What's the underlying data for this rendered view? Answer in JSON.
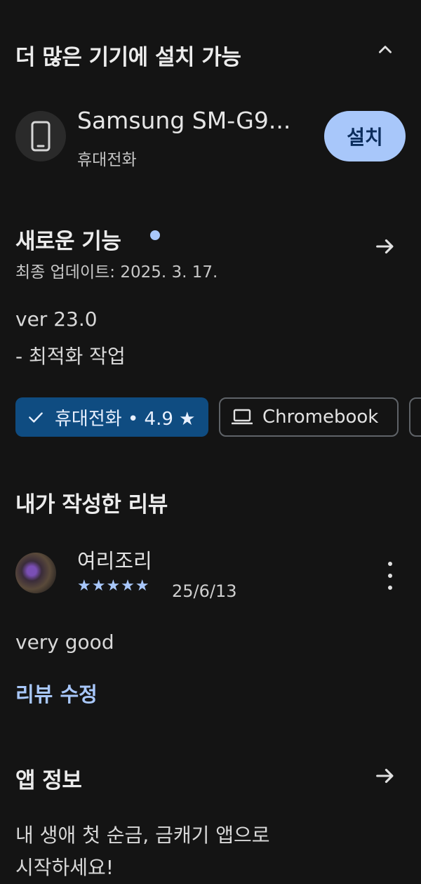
{
  "install_section": {
    "title": "더 많은 기기에 설치 가능",
    "device_name": "Samsung SM-G9...",
    "device_type": "휴대전화",
    "install_label": "설치"
  },
  "whats_new": {
    "title": "새로운 기능",
    "last_updated": "최종 업데이트: 2025. 3. 17.",
    "version": "ver 23.0",
    "note": "- 최적화 작업"
  },
  "device_chips": {
    "active_label": "휴대전화 • 4.9 ★",
    "chromebook_label": "Chromebook"
  },
  "my_review": {
    "title": "내가 작성한 리뷰",
    "author": "여리조리",
    "stars": "★★★★★",
    "rating": 5,
    "date": "25/6/13",
    "text": "very good",
    "edit_label": "리뷰 수정"
  },
  "app_info": {
    "title": "앱 정보",
    "description_line1": "내 생애 첫 순금, 금캐기 앱으로",
    "description_line2": "시작하세요!"
  },
  "colors": {
    "background": "#141414",
    "accent": "#a8c7fa",
    "chip_active": "#0f4c81"
  }
}
